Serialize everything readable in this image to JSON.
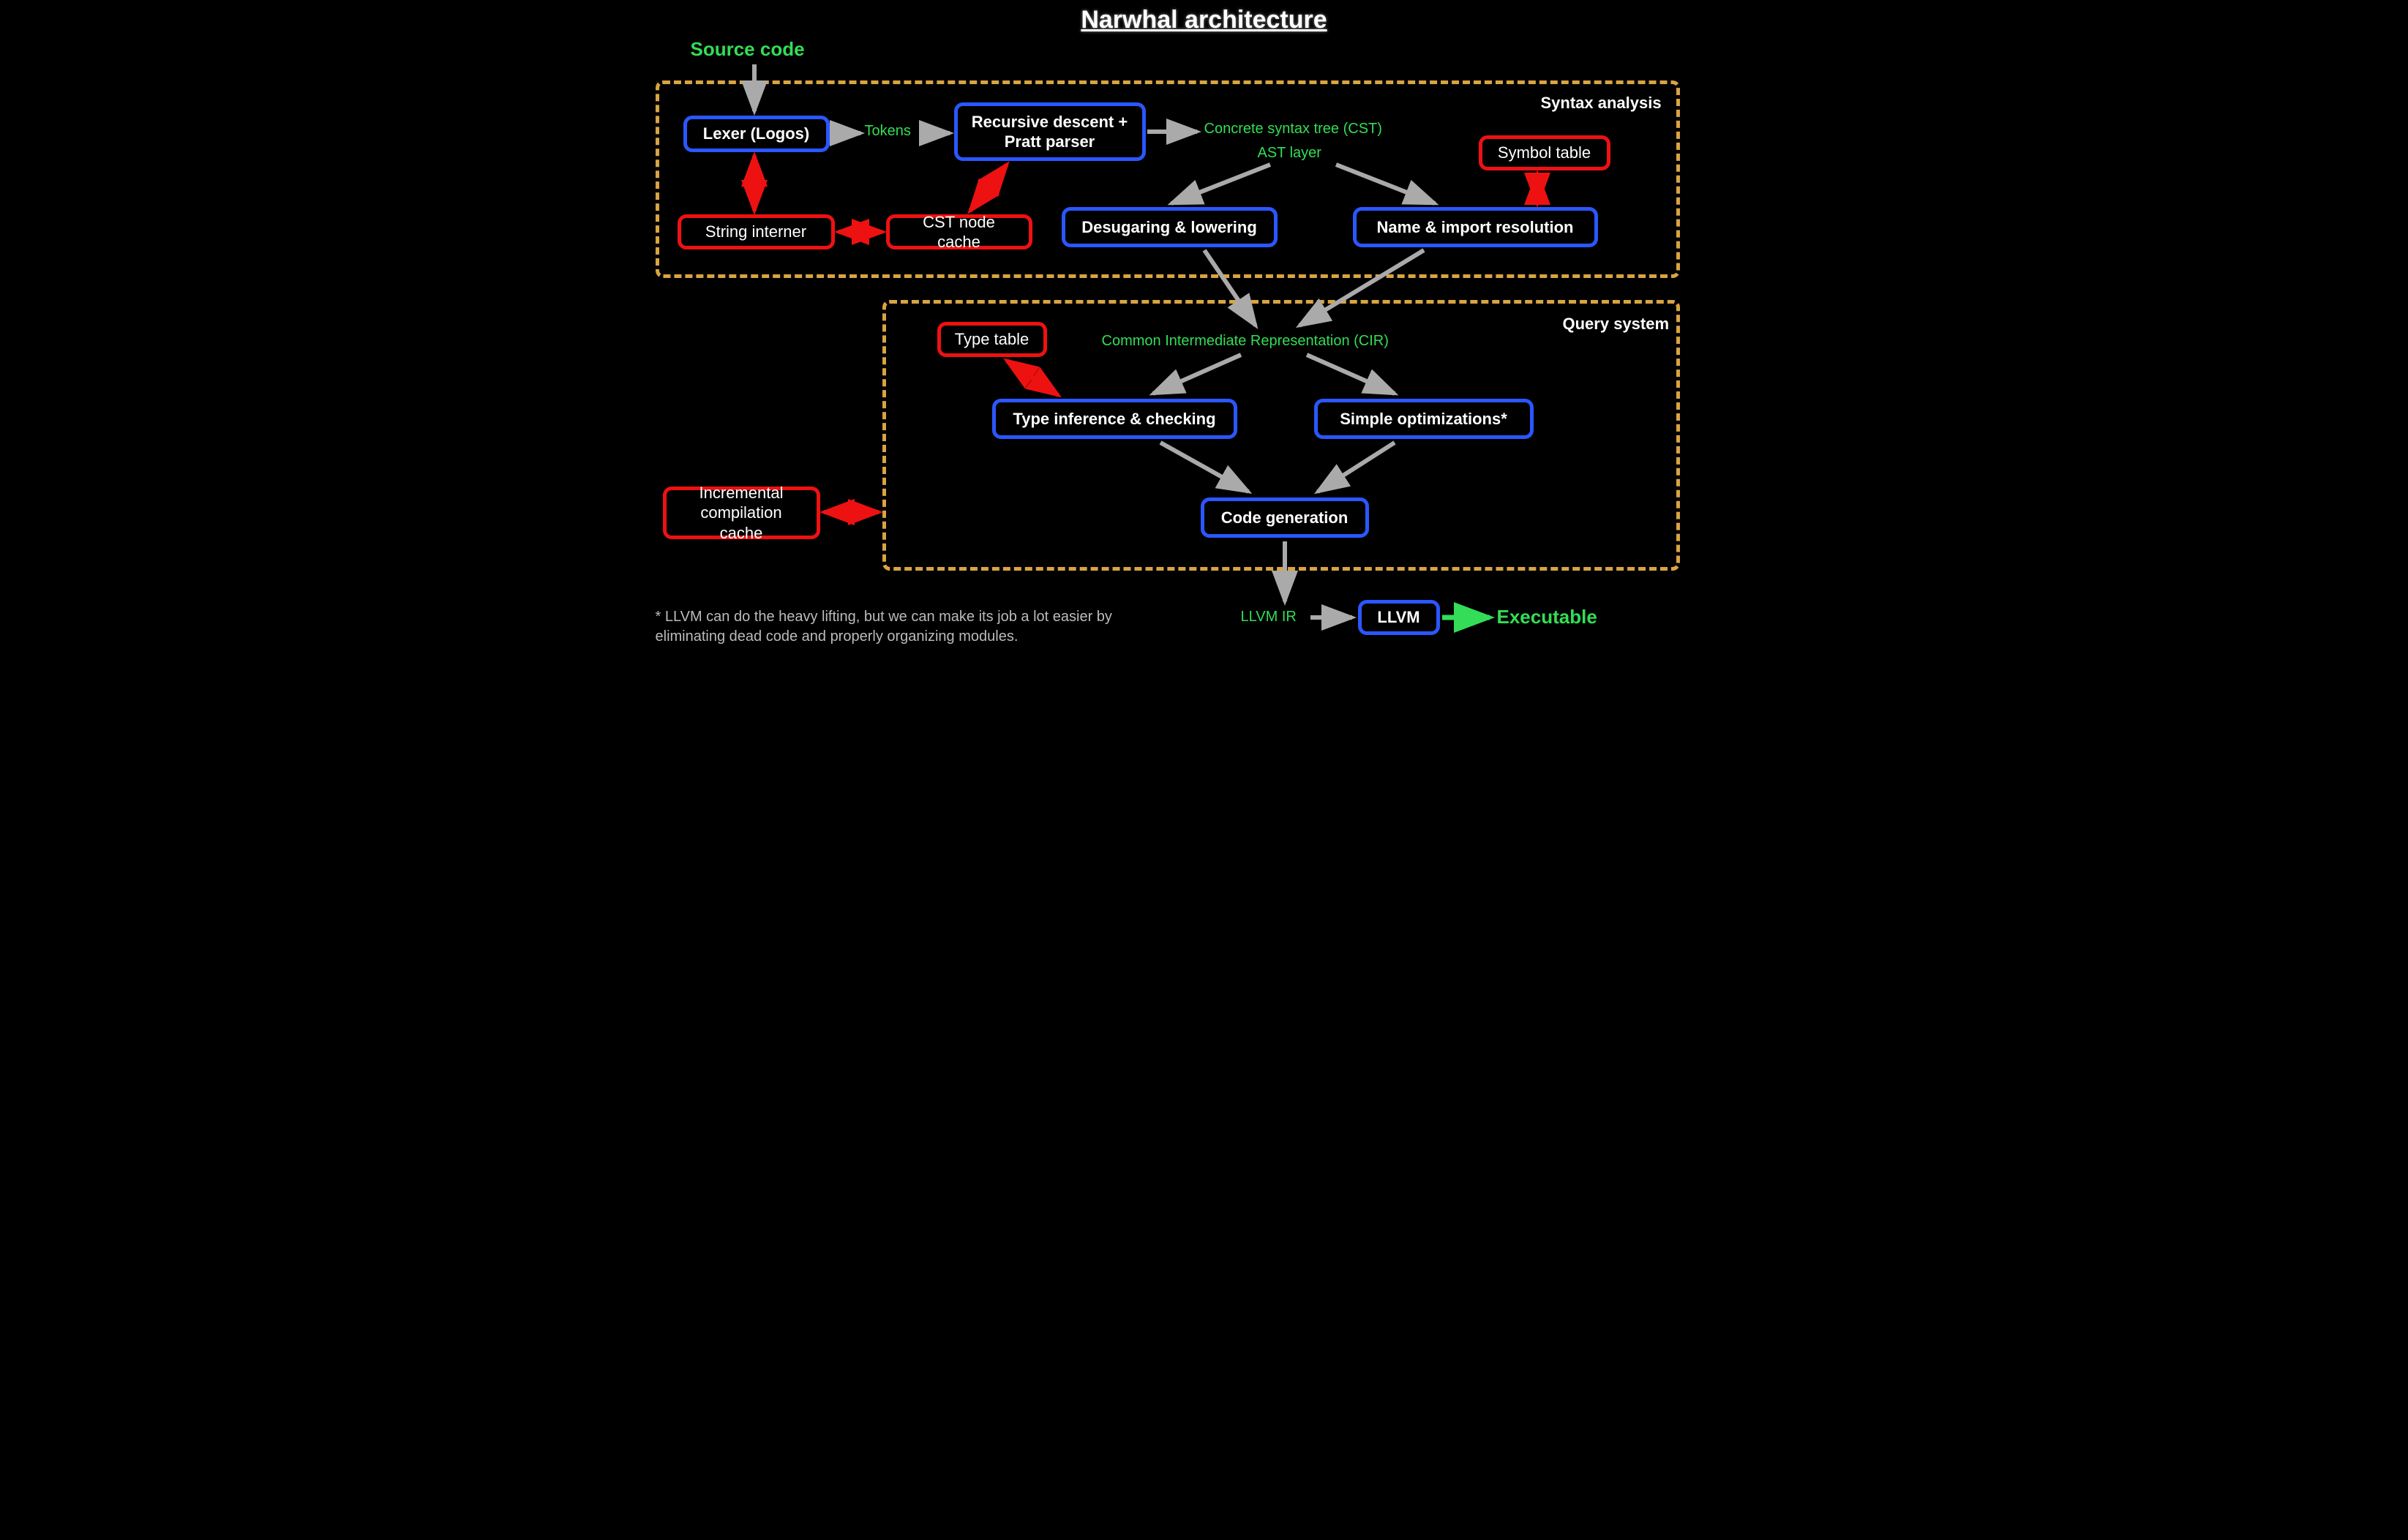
{
  "title": "Narwhal architecture",
  "labels": {
    "source_code": "Source code",
    "tokens": "Tokens",
    "cst": "Concrete syntax tree (CST)",
    "ast_layer": "AST layer",
    "cir": "Common Intermediate Representation (CIR)",
    "llvm_ir": "LLVM IR",
    "executable": "Executable"
  },
  "regions": {
    "syntax": "Syntax analysis",
    "query": "Query system"
  },
  "boxes": {
    "lexer": "Lexer (Logos)",
    "parser": "Recursive descent + Pratt parser",
    "symbol_table": "Symbol table",
    "string_interner": "String interner",
    "cst_cache": "CST node cache",
    "desugar": "Desugaring & lowering",
    "name_res": "Name & import resolution",
    "type_table": "Type table",
    "type_check": "Type inference & checking",
    "optimize": "Simple optimizations*",
    "codegen": "Code generation",
    "icc": "Incremental compilation cache",
    "llvm": "LLVM"
  },
  "footnote": "* LLVM can do the heavy lifting, but we can make its job a lot easier by eliminating dead code and properly organizing modules."
}
